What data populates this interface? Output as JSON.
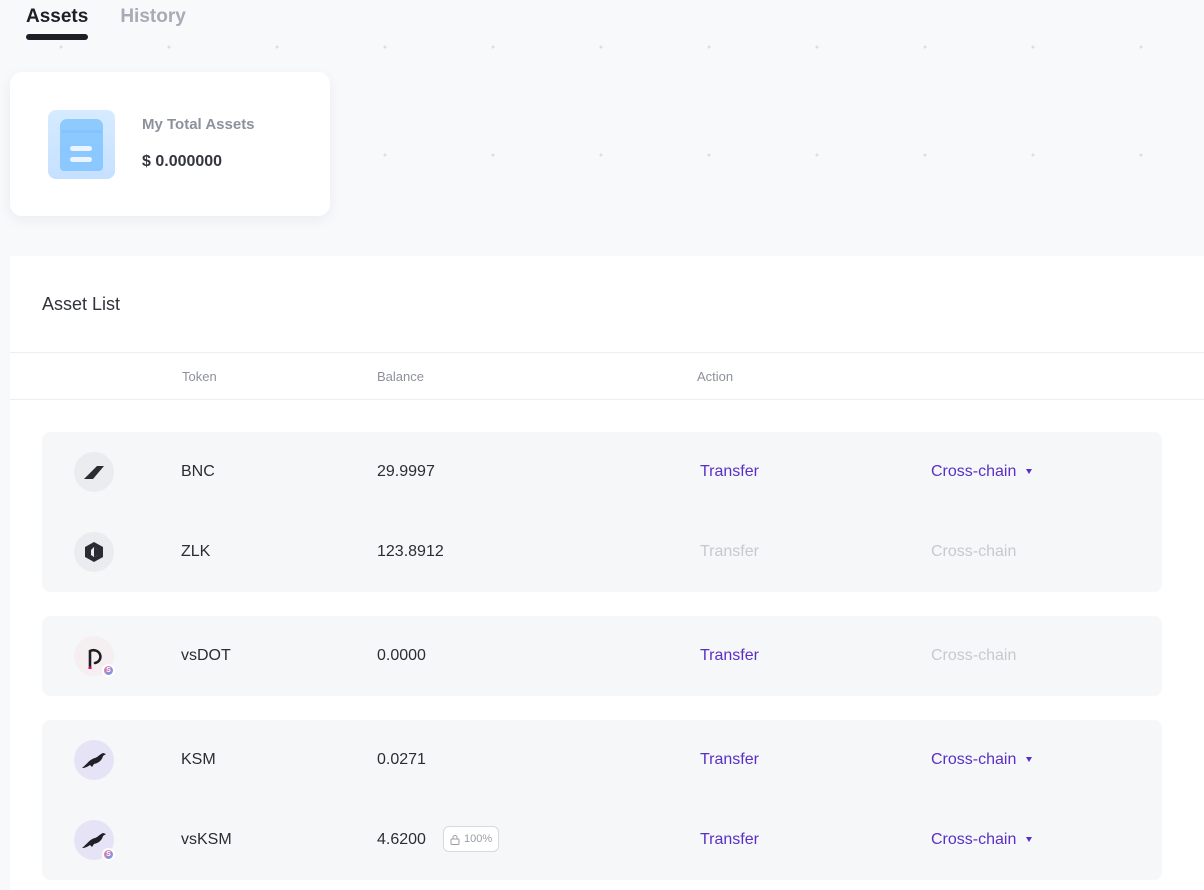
{
  "tabs": [
    {
      "label": "Assets",
      "active": true
    },
    {
      "label": "History",
      "active": false
    }
  ],
  "summary": {
    "label": "My Total Assets",
    "value": "$ 0.000000",
    "icon": "wallet-icon"
  },
  "asset_list": {
    "title": "Asset List",
    "columns": {
      "token": "Token",
      "balance": "Balance",
      "action": "Action"
    },
    "rows": [
      {
        "token": "BNC",
        "balance": "29.9997",
        "transfer": "Transfer",
        "cross_chain": "Cross-chain",
        "icon": "bnc-icon"
      },
      {
        "token": "ZLK",
        "balance": "123.8912",
        "transfer": "Transfer",
        "cross_chain": "Cross-chain",
        "icon": "zlk-icon"
      },
      {
        "token": "vsDOT",
        "balance": "0.0000",
        "transfer": "Transfer",
        "cross_chain": "Cross-chain",
        "icon": "polkadot-icon"
      },
      {
        "token": "KSM",
        "balance": "0.0271",
        "transfer": "Transfer",
        "cross_chain": "Cross-chain",
        "icon": "kusama-icon"
      },
      {
        "token": "vsKSM",
        "balance": "4.6200",
        "lock_percent": "100%",
        "transfer": "Transfer",
        "cross_chain": "Cross-chain",
        "icon": "kusama-icon"
      }
    ]
  },
  "colors": {
    "accent": "#5a2fc8",
    "disabled": "#c7c9cf",
    "background": "#f8f9fb"
  }
}
